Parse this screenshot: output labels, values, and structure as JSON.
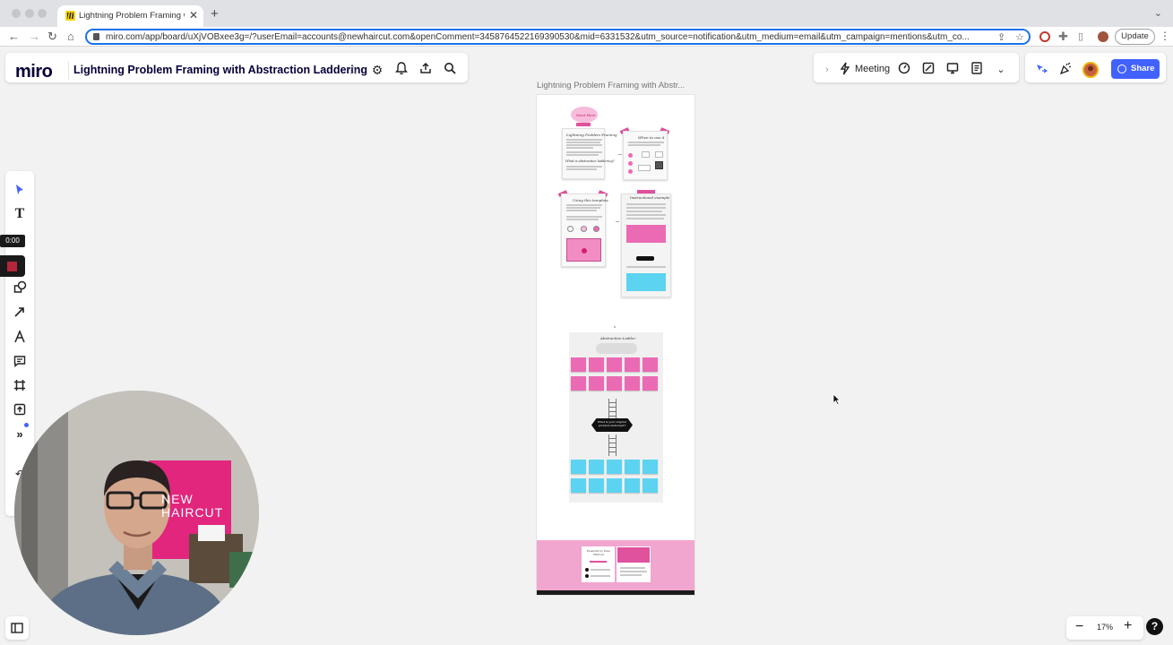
{
  "browser": {
    "tab_title": "Lightning Problem Framing wit",
    "tab_full_title": "Lightning Problem Framing with Abstraction Laddering",
    "url": "miro.com/app/board/uXjVOBxee3g=/?userEmail=accounts@newhaircut.com&openComment=3458764522169390530&mid=6331532&utm_source=notification&utm_medium=email&utm_campaign=mentions&utm_co...",
    "update_label": "Update"
  },
  "app": {
    "logo": "miro",
    "board_title": "Lightning Problem Framing with Abstraction Laddering"
  },
  "collab": {
    "meeting_label": "Meeting",
    "share_label": "Share"
  },
  "toolbar": {
    "timer": "0:00",
    "pen_color": "#b3263a",
    "items": [
      "select",
      "text",
      "sticky-note",
      "shapes",
      "connection-line",
      "pen",
      "comment",
      "frame",
      "upload",
      "more"
    ]
  },
  "board": {
    "frame_label": "Lightning Problem Framing with Abstr...",
    "sections": {
      "start_here": "Start Here",
      "intro_title": "Lightning Problem Framing",
      "abstraction_q": "What is abstraction laddering?",
      "when_to_use": "When to use it",
      "using_template": "Using this template",
      "instructional": "Instructional example",
      "ladder_title": "Abstraction Ladder",
      "problem_statement": "What is your original problem statement?",
      "powered_by": "Powered by New Haircut"
    }
  },
  "zoom": {
    "value": "17%",
    "minus": "−",
    "plus": "+"
  },
  "help_label": "?",
  "webcam": {
    "wall_text_line1": "NEW",
    "wall_text_line2": "HAIRCUT"
  },
  "colors": {
    "accent_blue": "#4262ff",
    "sticky_pink": "#ea6bb3",
    "sticky_blue": "#5cd3f0",
    "footer_pink": "#f0a6cf"
  }
}
